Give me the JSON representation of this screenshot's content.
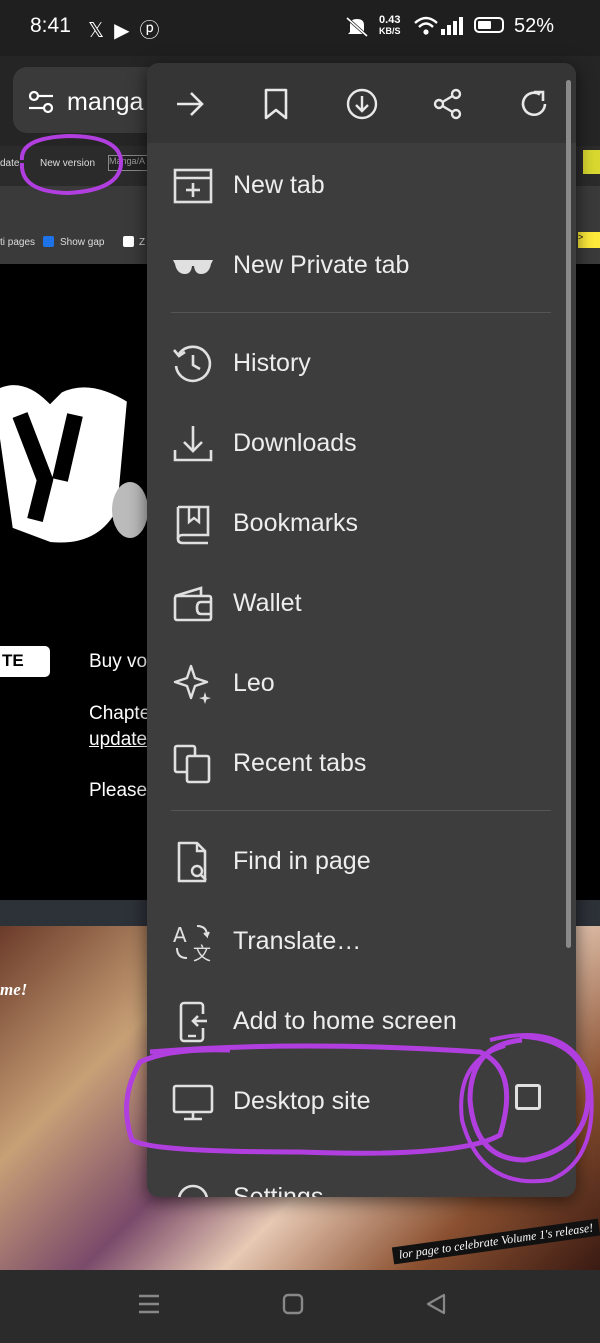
{
  "status_bar": {
    "time": "8:41",
    "speed_value": "0.43",
    "speed_unit": "KB/S",
    "battery": "52%",
    "app_icons": [
      "x-icon",
      "youtube-icon",
      "pinterest-icon"
    ]
  },
  "url_bar": {
    "text": "manga"
  },
  "background_page": {
    "link_update": "date",
    "new_version": "New version",
    "input_value": "Manga/A",
    "option_pages": "ti pages",
    "option_show_gap": "Show gap",
    "option_z": "Z",
    "yellow_tag": ">",
    "te_button": "TE",
    "text_buy": "Buy vo",
    "text_chapter": "Chapte",
    "text_update": "update",
    "text_please": "Please",
    "art_left_text": "me!",
    "art_caption": "lor page to celebrate Volume 1's release!"
  },
  "menu": {
    "toolbar": [
      {
        "name": "forward",
        "icon": "arrow-right-icon"
      },
      {
        "name": "bookmark",
        "icon": "bookmark-icon"
      },
      {
        "name": "download",
        "icon": "download-icon"
      },
      {
        "name": "share",
        "icon": "share-icon"
      },
      {
        "name": "reload",
        "icon": "reload-icon"
      }
    ],
    "items": {
      "new_tab": "New tab",
      "new_private_tab": "New Private tab",
      "history": "History",
      "downloads": "Downloads",
      "bookmarks": "Bookmarks",
      "wallet": "Wallet",
      "leo": "Leo",
      "recent_tabs": "Recent tabs",
      "find_in_page": "Find in page",
      "translate": "Translate…",
      "add_to_home_screen": "Add to home screen",
      "desktop_site": "Desktop site",
      "settings": "Settings"
    },
    "desktop_site_checked": false
  },
  "annotation_color": "#b13fe0",
  "accent_colors": {
    "menu_bg": "#3d3d3d",
    "menu_text": "#ededed"
  }
}
